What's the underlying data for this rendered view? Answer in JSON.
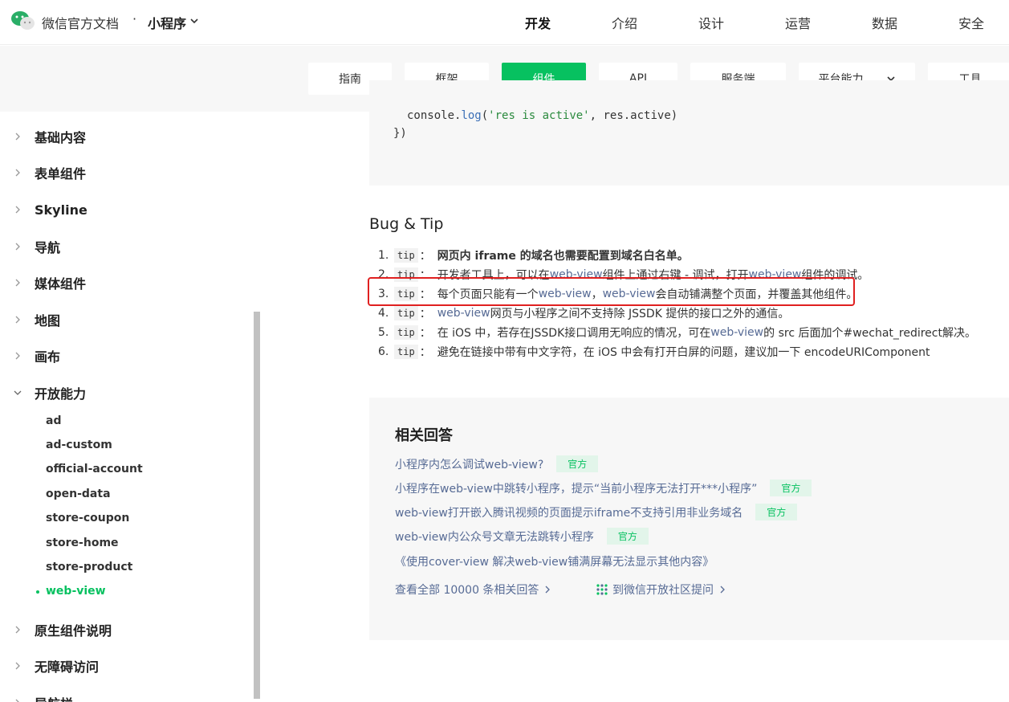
{
  "header": {
    "brand": "微信官方文档",
    "separator": "·",
    "product": "小程序",
    "nav": [
      "开发",
      "介绍",
      "设计",
      "运营",
      "数据",
      "安全"
    ]
  },
  "subnav": {
    "tabs": [
      "指南",
      "框架",
      "组件",
      "API",
      "服务端",
      "平台能力",
      "工具"
    ],
    "active": "组件"
  },
  "sidebar": {
    "items": [
      "基础内容",
      "表单组件",
      "Skyline",
      "导航",
      "媒体组件",
      "地图",
      "画布",
      "开放能力",
      "原生组件说明",
      "无障碍访问",
      "导航栏"
    ],
    "sub_items": [
      "ad",
      "ad-custom",
      "official-account",
      "open-data",
      "store-coupon",
      "store-home",
      "store-product",
      "web-view"
    ]
  },
  "code": {
    "line1_pre": "console.",
    "line1_fn": "log",
    "line1_open": "(",
    "line1_str": "'res is active'",
    "line1_post": ", res.active)",
    "line2": "})"
  },
  "bug_tip": {
    "title": "Bug & Tip",
    "tip_label": "tip",
    "colon": "：",
    "tips": [
      {
        "num": "1.",
        "text": "网页内 iframe 的域名也需要配置到域名白名单。"
      },
      {
        "num": "2.",
        "a": "开发者工具上，可以在 ",
        "link1": "web-view",
        "b": " 组件上通过右键 - 调试，打开 ",
        "link2": "web-view",
        "c": " 组件的调试。"
      },
      {
        "num": "3.",
        "a": "每个页面只能有一个 ",
        "link1": "web-view",
        "b": "，",
        "link2": "web-view",
        "c": " 会自动铺满整个页面，并覆盖其他组件。"
      },
      {
        "num": "4.",
        "link1": "web-view",
        "a": " 网页与小程序之间不支持除 JSSDK 提供的接口之外的通信。"
      },
      {
        "num": "5.",
        "a": "在 iOS 中，若存在JSSDK接口调用无响应的情况，可在 ",
        "link1": "web-view",
        "b": " 的 src 后面加个#wechat_redirect解决。"
      },
      {
        "num": "6.",
        "a": "避免在链接中带有中文字符，在 iOS 中会有打开白屏的问题，建议加一下 encodeURIComponent"
      }
    ]
  },
  "answers": {
    "title": "相关回答",
    "badge": "官方",
    "items": [
      "小程序内怎么调试web-view?",
      "小程序在web-view中跳转小程序，提示“当前小程序无法打开***小程序”",
      "web-view打开嵌入腾讯视频的页面提示iframe不支持引用非业务域名",
      "web-view内公众号文章无法跳转小程序",
      "《使用cover-view 解决web-view铺满屏幕无法显示其他内容》"
    ],
    "view_all": "查看全部 10000 条相关回答",
    "ask": "到微信开放社区提问"
  },
  "colors": {
    "accent": "#07c160",
    "link": "#576b95",
    "highlight": "#e02020"
  }
}
